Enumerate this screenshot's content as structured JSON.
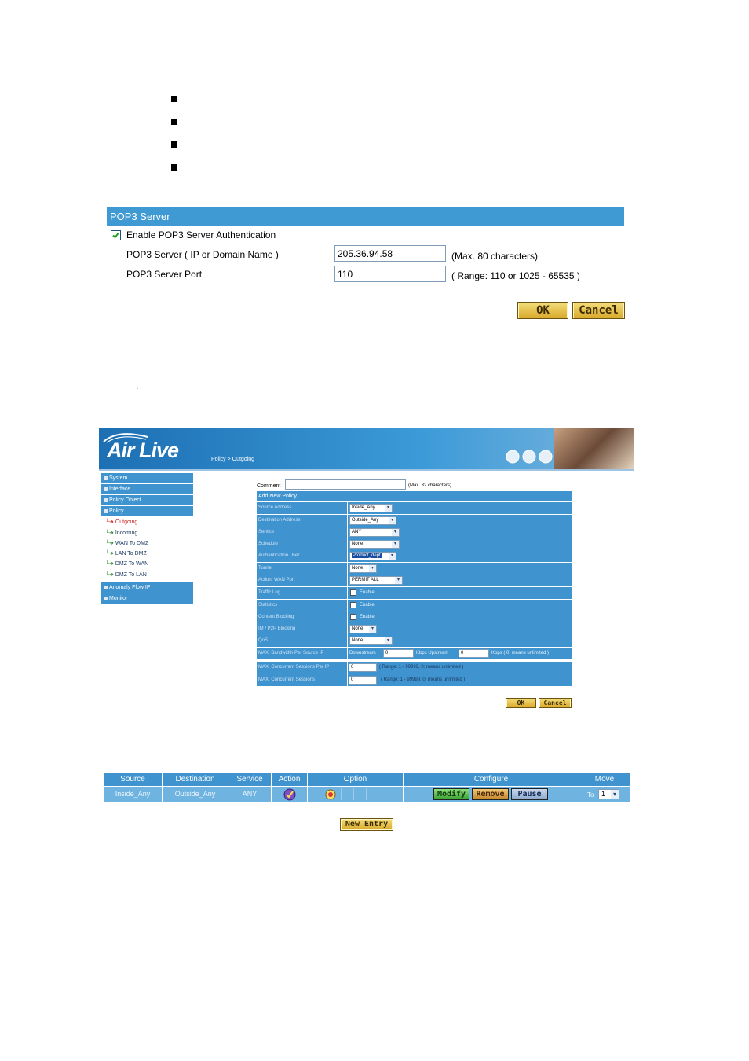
{
  "pop3": {
    "header": "POP3 Server",
    "enable_label": "Enable POP3 Server Authentication",
    "enable_checked": true,
    "server_label": "POP3 Server ( IP or Domain Name )",
    "server_value": "205.36.94.58",
    "server_hint": "(Max. 80 characters)",
    "port_label": "POP3 Server Port",
    "port_value": "110",
    "port_hint": "( Range: 110 or 1025 - 65535 )",
    "ok_label": "OK",
    "cancel_label": "Cancel"
  },
  "stray_dot": ".",
  "router": {
    "logo": "Air Live",
    "breadcrumb": "Policy > Outgoing",
    "nav": [
      {
        "label": "System"
      },
      {
        "label": "Interface"
      },
      {
        "label": "Policy Object"
      },
      {
        "label": "Policy"
      },
      {
        "label": "Anomaly Flow IP"
      },
      {
        "label": "Monitor"
      }
    ],
    "policy_sub": [
      "Outgoing",
      "Incoming",
      "WAN To DMZ",
      "LAN To DMZ",
      "DMZ To WAN",
      "DMZ To LAN"
    ],
    "comment_label": "Comment :",
    "comment_hint": "(Max. 32 characters)",
    "section_title": "Add New Policy",
    "rows": [
      {
        "label": "Source Address",
        "value": "Inside_Any"
      },
      {
        "label": "Destination Address",
        "value": "Outside_Any"
      },
      {
        "label": "Service",
        "value": "ANY"
      },
      {
        "label": "Schedule",
        "value": "None"
      },
      {
        "label": "Authentication User",
        "value": "Product_dept"
      },
      {
        "label": "Tunnel",
        "value": "None"
      },
      {
        "label": "Action, WAN Port",
        "value": "PERMIT ALL"
      },
      {
        "label": "Traffic Log",
        "value": "Enable"
      },
      {
        "label": "Statistics",
        "value": "Enable"
      },
      {
        "label": "Content Blocking",
        "value": "Enable"
      },
      {
        "label": "IM / P2P Blocking",
        "value": "None"
      },
      {
        "label": "QoS",
        "value": "None"
      },
      {
        "label": "MAX. Bandwidth Per Source IP",
        "downstream_label": "Downstream",
        "downstream_value": "0",
        "upstream_label": "Kbps Upstream",
        "upstream_value": "0",
        "hint": "Kbps ( 0: means unlimited )"
      },
      {
        "label": "MAX. Concurrent Sessions Per IP",
        "value": "0",
        "hint": "( Range: 1 - 99999, 0: means unlimited )"
      },
      {
        "label": "MAX. Concurrent Sessions",
        "value": "0",
        "hint": "( Range: 1 - 99999, 0: means unlimited )"
      }
    ],
    "ok_label": "OK",
    "cancel_label": "Cancel"
  },
  "policy_table": {
    "headers": [
      "Source",
      "Destination",
      "Service",
      "Action",
      "Option",
      "Configure",
      "Move"
    ],
    "row": {
      "source": "Inside_Any",
      "destination": "Outside_Any",
      "service": "ANY",
      "modify_label": "Modify",
      "remove_label": "Remove",
      "pause_label": "Pause",
      "move_prefix": "To",
      "move_value": "1"
    },
    "new_entry_label": "New Entry"
  }
}
